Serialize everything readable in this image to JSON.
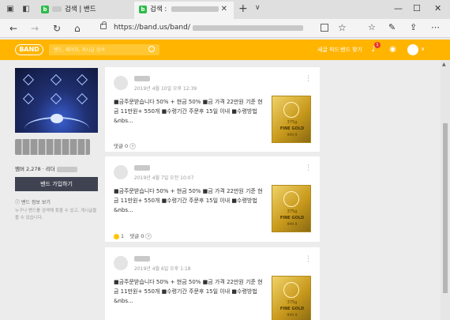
{
  "browser": {
    "tabs": [
      {
        "title": "검색 | 밴드",
        "active": false
      },
      {
        "title": "검색 :",
        "active": true
      }
    ],
    "new_tab_symbol": "+",
    "tab_menu_symbol": "∨",
    "window_controls": {
      "minimize": "—",
      "maximize": "☐",
      "close": "✕"
    },
    "nav": {
      "back": "←",
      "forward": "→",
      "refresh": "↻",
      "home": "⌂"
    },
    "url": "https://band.us/band/",
    "icons": [
      "tab-aside-icon",
      "tab-switch-icon",
      "favorites-icon",
      "notes-icon",
      "share-icon",
      "more-icon"
    ]
  },
  "band_header": {
    "logo": "BAND",
    "search_placeholder": "밴드, 페이지, 게시글 검색",
    "links": {
      "new_feed": "새글 피드",
      "find_band": "밴드 찾기"
    },
    "notification_count": "1",
    "accent_color": "#ffb400"
  },
  "sidebar": {
    "member_count_text": "멤버 2,278 · 리더",
    "join_button": "밴드 가입하기",
    "info_link": "밴드 정보 보기",
    "description": "누구나 밴드를 검색해 찾을 수 있고, 게시글을 볼 수 있습니다."
  },
  "posts": [
    {
      "date": "2019년 4월 10일 오후 12:39",
      "body": "■금주문받습니다 50% + 현금 50% ■금 가격 22만원 기준 현금 11만원+ 550개 ■수령기간 주문후 15일 이내 ■수령방법 &nbs...",
      "footer": {
        "comments": "댓글 0",
        "reactions": ""
      },
      "thumb": {
        "weight": "375g",
        "label": "FINE GOLD",
        "number": "999.9"
      }
    },
    {
      "date": "2019년 4월 7일 오전 10:07",
      "body": "■금주문받습니다 50% + 현금 50% ■금 가격 22만원 기준 현금 11만원+ 550개 ■수령기간 주문후 15일 이내 ■수령방법 &nbs...",
      "footer": {
        "comments": "댓글 0",
        "reactions": "1"
      },
      "thumb": {
        "weight": "375g",
        "label": "FINE GOLD",
        "number": "999.9"
      }
    },
    {
      "date": "2019년 4월 6일 오후 1:18",
      "body": "■금주문받습니다 50% + 현금 50% ■금 가격 22만원 기준 현금 11만원+ 550개 ■수령기간 주문후 15일 이내 ■수령방법 &nbs...",
      "footer": {
        "comments": "",
        "reactions": ""
      },
      "thumb": {
        "weight": "375g",
        "label": "FINE GOLD",
        "number": "999.9"
      }
    }
  ]
}
